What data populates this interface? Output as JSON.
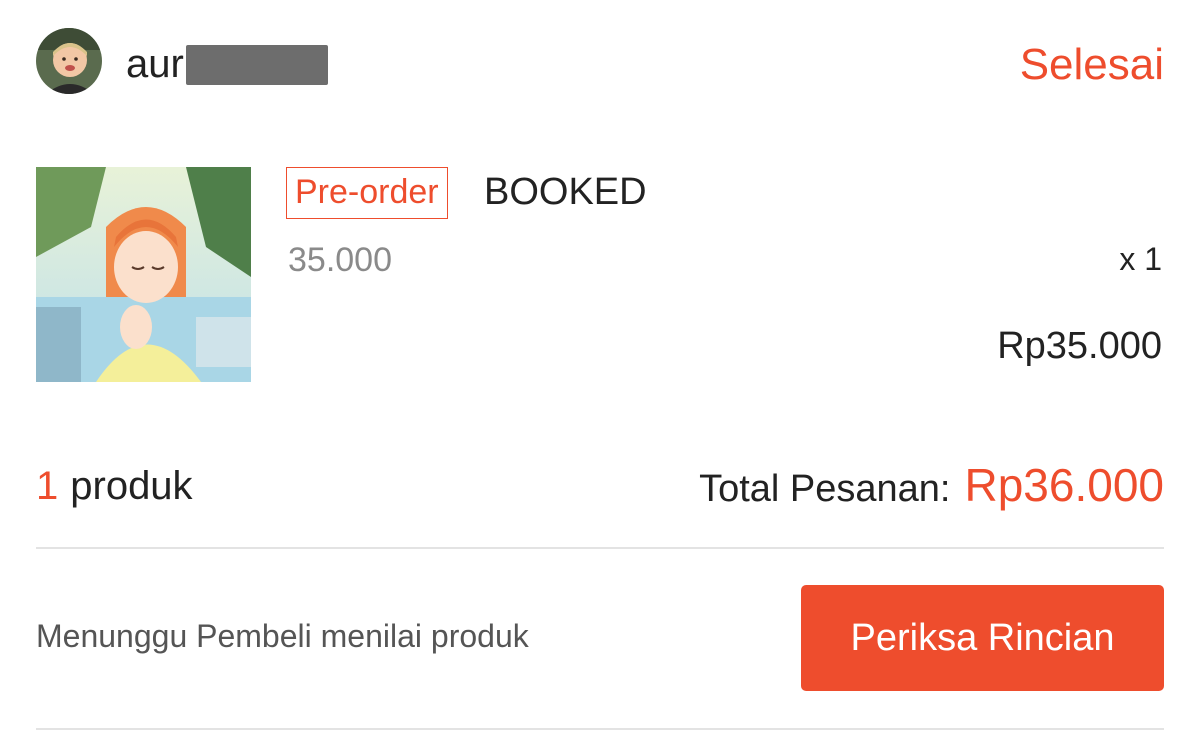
{
  "header": {
    "username_visible": "aur",
    "status": "Selesai"
  },
  "product": {
    "badge": "Pre-order",
    "name": "BOOKED",
    "variant": "35.000",
    "quantity": "x 1",
    "price": "Rp35.000"
  },
  "summary": {
    "count": "1",
    "count_label": "produk",
    "total_label": "Total Pesanan:",
    "total_amount": "Rp36.000"
  },
  "footer": {
    "note": "Menunggu Pembeli menilai produk",
    "button_label": "Periksa Rincian"
  },
  "colors": {
    "accent": "#ee4d2d",
    "divider": "#e3e3e3"
  }
}
